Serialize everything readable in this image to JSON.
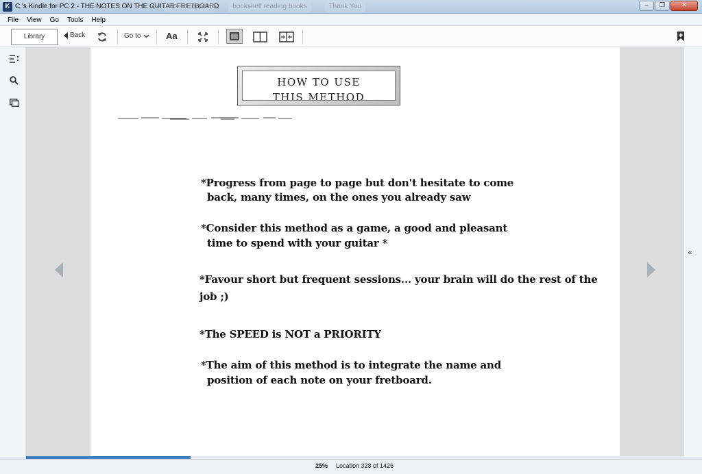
{
  "window": {
    "title": "C.'s Kindle for PC 2 - THE NOTES ON THE GUITAR FRETBOARD",
    "app_icon": "K",
    "background_tabs": [
      "Bol.fr Heppen",
      "bookshelf reading books",
      "Thank You"
    ],
    "controls": {
      "minimize": "‒",
      "restore": "❐",
      "close": "✕"
    }
  },
  "menu": {
    "items": [
      "File",
      "View",
      "Go",
      "Tools",
      "Help"
    ]
  },
  "toolbar": {
    "library_label": "Library",
    "back_label": "Back",
    "sync_icon": "sync-icon",
    "goto_label": "Go to",
    "font_label": "Aa",
    "fullscreen_icon": "fullscreen-icon",
    "layout_modes": [
      "single-column",
      "two-column",
      "fit-width"
    ],
    "bookmark_icon": "bookmark-add-icon"
  },
  "sidebar": {
    "icons": [
      "table-of-contents-icon",
      "search-icon",
      "flashcards-icon"
    ]
  },
  "book": {
    "banner_line1": "HOW TO USE",
    "banner_line2": "THIS METHOD",
    "paragraphs": [
      {
        "line1": "*Progress from page to page but don't hesitate to come",
        "line2": "back, many times, on the ones you already saw"
      },
      {
        "line1": "*Consider this method as a game, a good and pleasant",
        "line2": "time to spend with your guitar *"
      },
      {
        "line1": "*Favour short but frequent sessions... your brain will do the rest of the",
        "line2": "job ;)"
      },
      {
        "line1": "*The SPEED is NOT a PRIORITY",
        "line2": ""
      },
      {
        "line1": "*The aim of this method is to integrate the name and",
        "line2": "position of each note on your fretboard."
      }
    ]
  },
  "navigation": {
    "prev_icon": "chevron-left-icon",
    "next_icon": "chevron-right-icon",
    "collapse_label": "«"
  },
  "status": {
    "percent_text": "25%",
    "location_text": "Location 328 of 1426",
    "progress_fraction": 0.25,
    "accent_color": "#3b7fbf"
  }
}
